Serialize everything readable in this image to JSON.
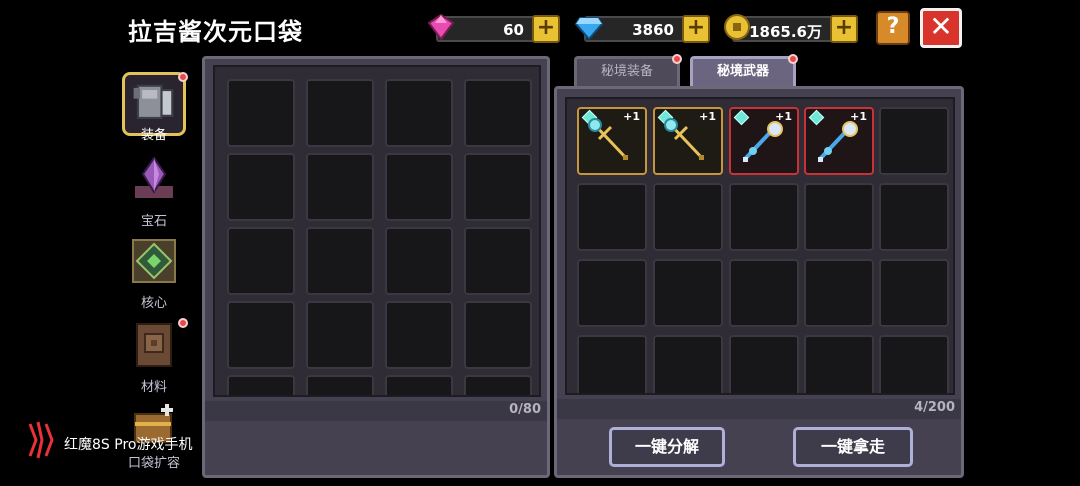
{
  "window": {
    "title": "拉吉酱次元口袋"
  },
  "currency": [
    {
      "icon": "pink-gem-icon",
      "value": "60",
      "color": "#e84cb0"
    },
    {
      "icon": "blue-diamond-icon",
      "value": "3860",
      "color": "#3aa8f0"
    },
    {
      "icon": "gold-coin-icon",
      "value": "1865.6万",
      "color": "#e8c233"
    }
  ],
  "buttons": {
    "help": "?",
    "close": "✕",
    "decompose": "一键分解",
    "take_all": "一键拿走"
  },
  "sidebar": {
    "items": [
      {
        "label": "装备",
        "icon": "armor-icon",
        "active": true,
        "badge": true
      },
      {
        "label": "宝石",
        "icon": "gem-crystal-icon",
        "active": false,
        "badge": false
      },
      {
        "label": "核心",
        "icon": "core-icon",
        "active": false,
        "badge": false
      },
      {
        "label": "材料",
        "icon": "material-book-icon",
        "active": false,
        "badge": true
      },
      {
        "label": "口袋扩容",
        "icon": "chest-expand-icon",
        "active": false,
        "badge": false
      }
    ]
  },
  "left_panel": {
    "count": "0/80"
  },
  "right_panel": {
    "tabs": [
      {
        "label": "秘境装备",
        "active": false,
        "badge": true
      },
      {
        "label": "秘境武器",
        "active": true,
        "badge": true
      }
    ],
    "count": "4/200",
    "items": [
      {
        "icon": "light-staff-icon",
        "level": "+1",
        "rarity": "gold"
      },
      {
        "icon": "light-staff-icon",
        "level": "+1",
        "rarity": "gold"
      },
      {
        "icon": "crystal-scepter-icon",
        "level": "+1",
        "rarity": "red"
      },
      {
        "icon": "crystal-scepter-icon",
        "level": "+1",
        "rarity": "red"
      }
    ]
  },
  "watermark": {
    "text": "红魔8S Pro游戏手机"
  },
  "colors": {
    "panel": "#454150",
    "slot": "#171719",
    "gold": "#c7963a",
    "red": "#c8333a"
  }
}
